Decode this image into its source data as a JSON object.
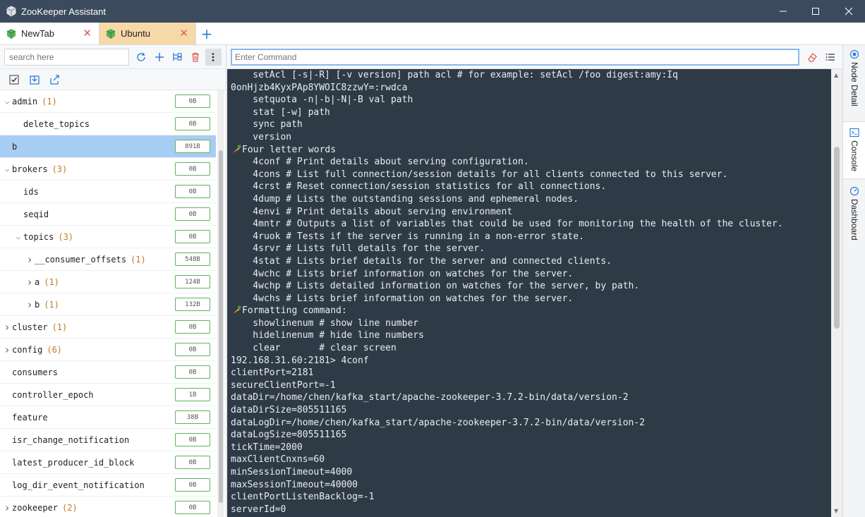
{
  "window": {
    "title": "ZooKeeper Assistant"
  },
  "tabs": [
    {
      "label": "NewTab"
    },
    {
      "label": "Ubuntu"
    }
  ],
  "sidebar": {
    "search_placeholder": "search here",
    "nodes": [
      {
        "name": "admin",
        "count": "(1)",
        "size": "0B",
        "chev": "down",
        "indent": 0
      },
      {
        "name": "delete_topics",
        "count": "",
        "size": "0B",
        "chev": "none",
        "indent": 1
      },
      {
        "name": "b",
        "count": "",
        "size": "891B",
        "chev": "none",
        "indent": 0,
        "selected": true
      },
      {
        "name": "brokers",
        "count": "(3)",
        "size": "0B",
        "chev": "down",
        "indent": 0
      },
      {
        "name": "ids",
        "count": "",
        "size": "0B",
        "chev": "none",
        "indent": 1
      },
      {
        "name": "seqid",
        "count": "",
        "size": "0B",
        "chev": "none",
        "indent": 1
      },
      {
        "name": "topics",
        "count": "(3)",
        "size": "0B",
        "chev": "down",
        "indent": 1
      },
      {
        "name": "__consumer_offsets",
        "count": "(1)",
        "size": "548B",
        "chev": "right",
        "indent": 2
      },
      {
        "name": "a",
        "count": "(1)",
        "size": "124B",
        "chev": "right",
        "indent": 2
      },
      {
        "name": "b",
        "count": "(1)",
        "size": "132B",
        "chev": "right",
        "indent": 2
      },
      {
        "name": "cluster",
        "count": "(1)",
        "size": "0B",
        "chev": "right",
        "indent": 0
      },
      {
        "name": "config",
        "count": "(6)",
        "size": "0B",
        "chev": "right",
        "indent": 0
      },
      {
        "name": "consumers",
        "count": "",
        "size": "0B",
        "chev": "none",
        "indent": 0
      },
      {
        "name": "controller_epoch",
        "count": "",
        "size": "1B",
        "chev": "none",
        "indent": 0
      },
      {
        "name": "feature",
        "count": "",
        "size": "38B",
        "chev": "none",
        "indent": 0
      },
      {
        "name": "isr_change_notification",
        "count": "",
        "size": "0B",
        "chev": "none",
        "indent": 0
      },
      {
        "name": "latest_producer_id_block",
        "count": "",
        "size": "0B",
        "chev": "none",
        "indent": 0
      },
      {
        "name": "log_dir_event_notification",
        "count": "",
        "size": "0B",
        "chev": "none",
        "indent": 0
      },
      {
        "name": "zookeeper",
        "count": "(2)",
        "size": "0B",
        "chev": "right",
        "indent": 0
      }
    ]
  },
  "command": {
    "placeholder": "Enter Command"
  },
  "console": {
    "lines": [
      {
        "icon": false,
        "text": "    setAcl [-s|-R] [-v version] path acl # for example: setAcl /foo digest:amy:Iq"
      },
      {
        "icon": false,
        "text": "0onHjzb4KyxPAp8YWOIC8zzwY=:rwdca"
      },
      {
        "icon": false,
        "text": "    setquota -n|-b|-N|-B val path"
      },
      {
        "icon": false,
        "text": "    stat [-w] path"
      },
      {
        "icon": false,
        "text": "    sync path"
      },
      {
        "icon": false,
        "text": "    version"
      },
      {
        "icon": true,
        "text": "Four letter words"
      },
      {
        "icon": false,
        "text": "    4conf # Print details about serving configuration."
      },
      {
        "icon": false,
        "text": "    4cons # List full connection/session details for all clients connected to this server."
      },
      {
        "icon": false,
        "text": "    4crst # Reset connection/session statistics for all connections."
      },
      {
        "icon": false,
        "text": "    4dump # Lists the outstanding sessions and ephemeral nodes."
      },
      {
        "icon": false,
        "text": "    4envi # Print details about serving environment"
      },
      {
        "icon": false,
        "text": "    4mntr # Outputs a list of variables that could be used for monitoring the health of the cluster."
      },
      {
        "icon": false,
        "text": "    4ruok # Tests if the server is running in a non-error state."
      },
      {
        "icon": false,
        "text": "    4srvr # Lists full details for the server."
      },
      {
        "icon": false,
        "text": "    4stat # Lists brief details for the server and connected clients."
      },
      {
        "icon": false,
        "text": "    4wchc # Lists brief information on watches for the server."
      },
      {
        "icon": false,
        "text": "    4wchp # Lists detailed information on watches for the server, by path."
      },
      {
        "icon": false,
        "text": "    4wchs # Lists brief information on watches for the server."
      },
      {
        "icon": true,
        "text": "Formatting command:"
      },
      {
        "icon": false,
        "text": "    showlinenum # show line number"
      },
      {
        "icon": false,
        "text": "    hidelinenum # hide line numbers"
      },
      {
        "icon": false,
        "text": "    clear       # clear screen"
      },
      {
        "icon": false,
        "text": "192.168.31.60:2181> 4conf"
      },
      {
        "icon": false,
        "text": "clientPort=2181"
      },
      {
        "icon": false,
        "text": "secureClientPort=-1"
      },
      {
        "icon": false,
        "text": "dataDir=/home/chen/kafka_start/apache-zookeeper-3.7.2-bin/data/version-2"
      },
      {
        "icon": false,
        "text": "dataDirSize=805511165"
      },
      {
        "icon": false,
        "text": "dataLogDir=/home/chen/kafka_start/apache-zookeeper-3.7.2-bin/data/version-2"
      },
      {
        "icon": false,
        "text": "dataLogSize=805511165"
      },
      {
        "icon": false,
        "text": "tickTime=2000"
      },
      {
        "icon": false,
        "text": "maxClientCnxns=60"
      },
      {
        "icon": false,
        "text": "minSessionTimeout=4000"
      },
      {
        "icon": false,
        "text": "maxSessionTimeout=40000"
      },
      {
        "icon": false,
        "text": "clientPortListenBacklog=-1"
      },
      {
        "icon": false,
        "text": "serverId=0"
      }
    ]
  },
  "right_tabs": [
    {
      "label": "Node Detail"
    },
    {
      "label": "Console"
    },
    {
      "label": "Dashboard"
    }
  ],
  "colors": {
    "titlebar": "#3b4a5c",
    "console_bg": "#2f3a47",
    "selected_row": "#a8cdf5",
    "active_tab": "#f7d8a8"
  }
}
